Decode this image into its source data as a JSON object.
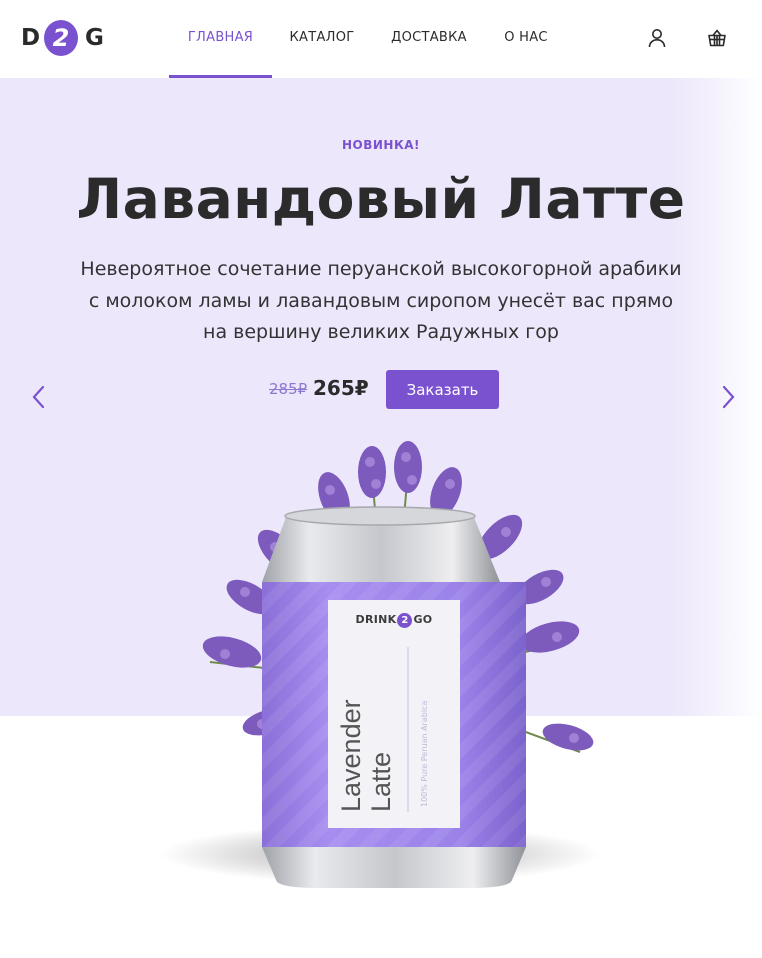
{
  "brand": {
    "logo_left": "D",
    "logo_middle": "2",
    "logo_right": "G",
    "accent_color": "#7a52cf"
  },
  "nav": {
    "items": [
      {
        "label": "ГЛАВНАЯ",
        "active": true
      },
      {
        "label": "КАТАЛОГ",
        "active": false
      },
      {
        "label": "ДОСТАВКА",
        "active": false
      },
      {
        "label": "О НАС",
        "active": false
      }
    ]
  },
  "header_icons": [
    "user-icon",
    "basket-icon"
  ],
  "hero": {
    "badge": "НОВИНКА!",
    "title": "Лавандовый Латте",
    "description": "Невероятное сочетание перуанской высокогорной арабики с молоком ламы и лавандовым сиропом унесёт вас прямо на вершину великих Радужных гор",
    "old_price": "285₽",
    "new_price": "265₽",
    "order_button": "Заказать",
    "background_color": "#ece7fb",
    "arrows": [
      "chevron-left-icon",
      "chevron-right-icon"
    ]
  },
  "product": {
    "can_brand_left": "DRINK",
    "can_brand_middle": "2",
    "can_brand_right": "GO",
    "can_name": "Lavender Latte",
    "can_name_line1": "Lavender",
    "can_name_line2": "Latte",
    "can_subtitle": "100% Pure Peruan Arabica",
    "can_color": "#9a7fe6"
  }
}
